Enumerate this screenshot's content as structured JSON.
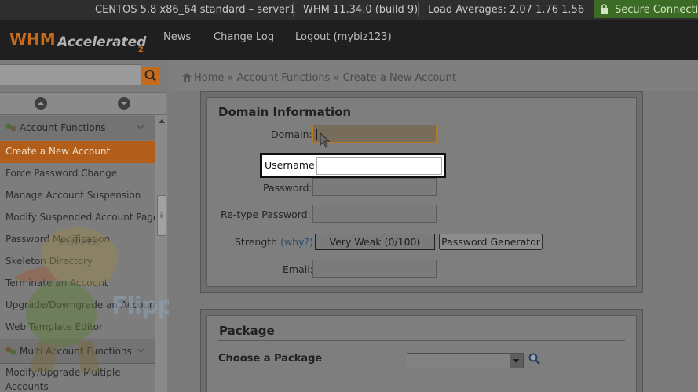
{
  "topbar": {
    "server": "CENTOS 5.8 x86_64 standard – server1",
    "version": "WHM 11.34.0 (build 9)",
    "load": "Load Averages: 2.07 1.76 1.56",
    "secure": "Secure Connecti"
  },
  "header": {
    "logo": "WHM Accelerated 2",
    "nav": [
      {
        "label": "News"
      },
      {
        "label": "Change Log"
      },
      {
        "label": "Logout (mybiz123)"
      }
    ]
  },
  "sidebar": {
    "search": {
      "value": "",
      "placeholder": ""
    },
    "section1": "Account Functions",
    "items": [
      {
        "label": "Create a New Account",
        "active": true
      },
      {
        "label": "Force Password Change"
      },
      {
        "label": "Manage Account Suspension"
      },
      {
        "label": "Modify Suspended Account Page"
      },
      {
        "label": "Password Modification"
      },
      {
        "label": "Skeleton Directory"
      },
      {
        "label": "Terminate an Account"
      },
      {
        "label": "Upgrade/Downgrade an Account"
      },
      {
        "label": "Web Template Editor"
      }
    ],
    "section2": "Multi Account Functions",
    "items2": [
      {
        "label": "Modify/Upgrade Multiple"
      },
      {
        "label": "Accounts"
      }
    ]
  },
  "breadcrumb": {
    "home": "Home",
    "sep": "»",
    "level1": "Account Functions",
    "current": "Create a New Account"
  },
  "domain_info": {
    "title": "Domain Information",
    "domain_label": "Domain:",
    "username_label": "Username:",
    "password_label": "Password:",
    "retype_label": "Re-type Password:",
    "strength_label": "Strength",
    "why": "(why?):",
    "strength_value": "Very Weak (0/100)",
    "generator": "Password Generator",
    "email_label": "Email:"
  },
  "package": {
    "title": "Package",
    "choose_label": "Choose a Package",
    "selected": "---"
  },
  "watermark": {
    "brand": "FlipperHost",
    "badge": "FLIPPER"
  },
  "colors": {
    "accent": "#c46b1c",
    "active_item": "#b25d1a",
    "secure_bg": "#3c6b25"
  }
}
